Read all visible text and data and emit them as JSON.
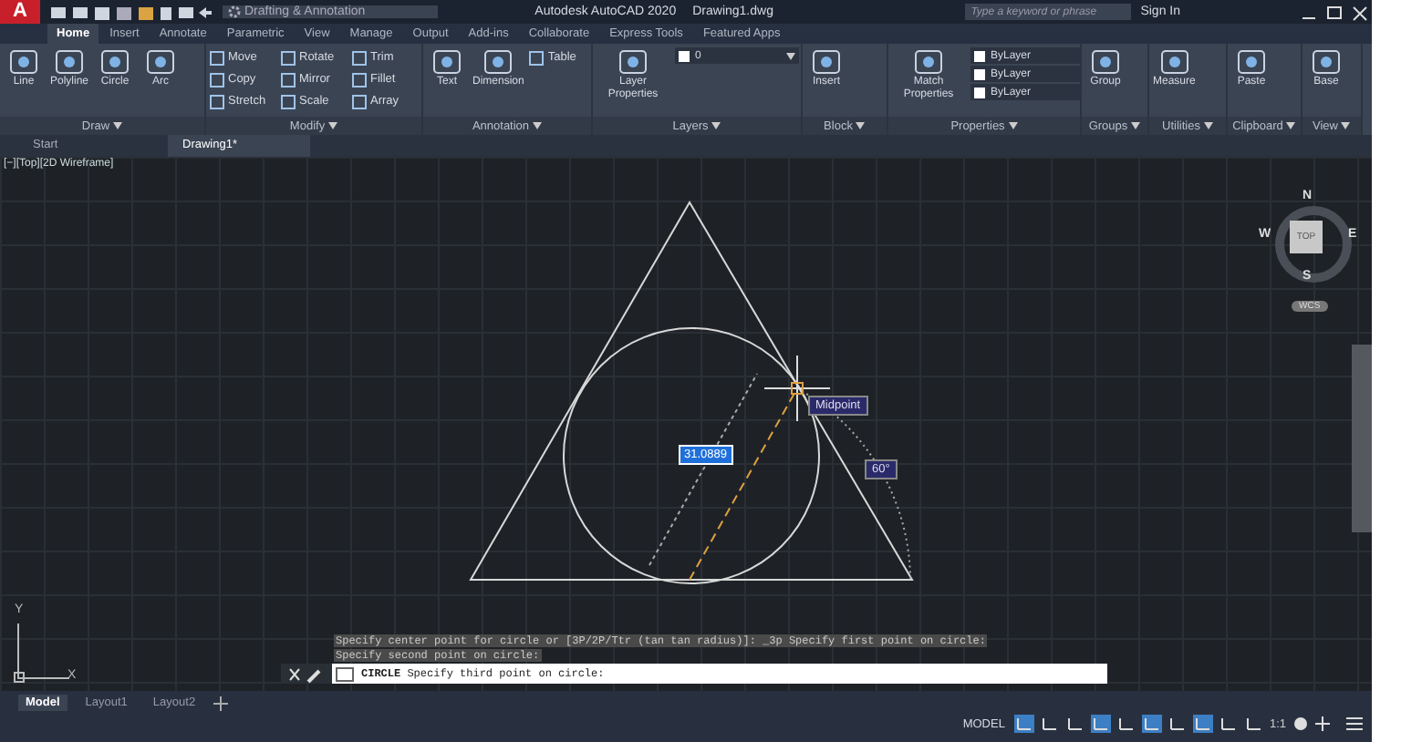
{
  "title_bar": {
    "app_button": "A",
    "workspace": "Drafting & Annotation",
    "title": "Autodesk AutoCAD 2020",
    "file": "Drawing1.dwg",
    "search": {
      "placeholder": "Type a keyword or phrase"
    },
    "sign_in": "Sign In"
  },
  "ribbon_tabs": [
    {
      "label": "Home",
      "selected": true
    },
    {
      "label": "Insert",
      "selected": false
    },
    {
      "label": "Annotate",
      "selected": false
    },
    {
      "label": "Parametric",
      "selected": false
    },
    {
      "label": "View",
      "selected": false
    },
    {
      "label": "Manage",
      "selected": false
    },
    {
      "label": "Output",
      "selected": false
    },
    {
      "label": "Add-ins",
      "selected": false
    },
    {
      "label": "Collaborate",
      "selected": false
    },
    {
      "label": "Express Tools",
      "selected": false
    },
    {
      "label": "Featured Apps",
      "selected": false
    }
  ],
  "ribbon_panels": [
    {
      "title": "Draw",
      "tools": [
        {
          "kind": "large",
          "label": "Line"
        },
        {
          "kind": "large",
          "label": "Polyline"
        },
        {
          "kind": "large",
          "label": "Circle"
        },
        {
          "kind": "large",
          "label": "Arc"
        }
      ]
    },
    {
      "title": "Modify",
      "tools": [
        {
          "kind": "small",
          "label": "Move"
        },
        {
          "kind": "small",
          "label": "Copy"
        },
        {
          "kind": "small",
          "label": "Stretch"
        },
        {
          "kind": "small",
          "label": "Rotate"
        },
        {
          "kind": "small",
          "label": "Mirror"
        },
        {
          "kind": "small",
          "label": "Scale"
        },
        {
          "kind": "small",
          "label": "Trim"
        },
        {
          "kind": "small",
          "label": "Fillet"
        },
        {
          "kind": "small",
          "label": "Array"
        }
      ]
    },
    {
      "title": "Annotation",
      "tools": [
        {
          "kind": "large",
          "label": "Text"
        },
        {
          "kind": "large",
          "label": "Dimension"
        },
        {
          "kind": "small",
          "label": "Table"
        }
      ]
    },
    {
      "title": "Layers",
      "tools": [
        {
          "kind": "large",
          "label": "Layer Properties"
        },
        {
          "kind": "dropdown",
          "label": "0"
        }
      ]
    },
    {
      "title": "Block",
      "tools": [
        {
          "kind": "large",
          "label": "Insert"
        }
      ]
    },
    {
      "title": "Properties",
      "tools": [
        {
          "kind": "large",
          "label": "Match Properties"
        },
        {
          "kind": "dropdown",
          "label": "ByLayer"
        },
        {
          "kind": "dropdown",
          "label": "ByLayer"
        },
        {
          "kind": "dropdown",
          "label": "ByLayer"
        }
      ]
    },
    {
      "title": "Groups",
      "tools": [
        {
          "kind": "large",
          "label": "Group"
        }
      ]
    },
    {
      "title": "Utilities",
      "tools": [
        {
          "kind": "large",
          "label": "Measure"
        }
      ]
    },
    {
      "title": "Clipboard",
      "tools": [
        {
          "kind": "large",
          "label": "Paste"
        }
      ]
    },
    {
      "title": "View",
      "tools": [
        {
          "kind": "large",
          "label": "Base"
        }
      ]
    }
  ],
  "file_tabs": [
    {
      "label": "Start",
      "selected": false
    },
    {
      "label": "Drawing1*",
      "selected": true
    }
  ],
  "viewport": {
    "label": "[−][Top][2D Wireframe]",
    "dimension_input": "31.0889",
    "snap_tooltip": "Midpoint",
    "angle_label": "60°",
    "viewcube": {
      "face": "TOP",
      "north": "N",
      "south": "S",
      "east": "E",
      "west": "W",
      "ucs": "WCS"
    },
    "ucs_axes": {
      "x": "X",
      "y": "Y"
    }
  },
  "command": {
    "history": [
      "Specify center point for circle or [3P/2P/Ttr (tan tan radius)]: _3p Specify first point on circle:",
      "Specify second point on circle:"
    ],
    "prompt": "**CIRCLE** Specify third point on circle:"
  },
  "layout_tabs": [
    {
      "label": "Model",
      "selected": true
    },
    {
      "label": "Layout1",
      "selected": false
    },
    {
      "label": "Layout2",
      "selected": false
    }
  ],
  "status_bar": {
    "mode": "MODEL",
    "toggles": [
      {
        "on": true
      },
      {
        "on": false
      },
      {
        "on": false
      },
      {
        "on": true
      },
      {
        "on": false
      },
      {
        "on": true
      },
      {
        "on": false
      },
      {
        "on": true
      },
      {
        "on": false
      },
      {
        "on": false
      }
    ],
    "scale": "1:1"
  }
}
